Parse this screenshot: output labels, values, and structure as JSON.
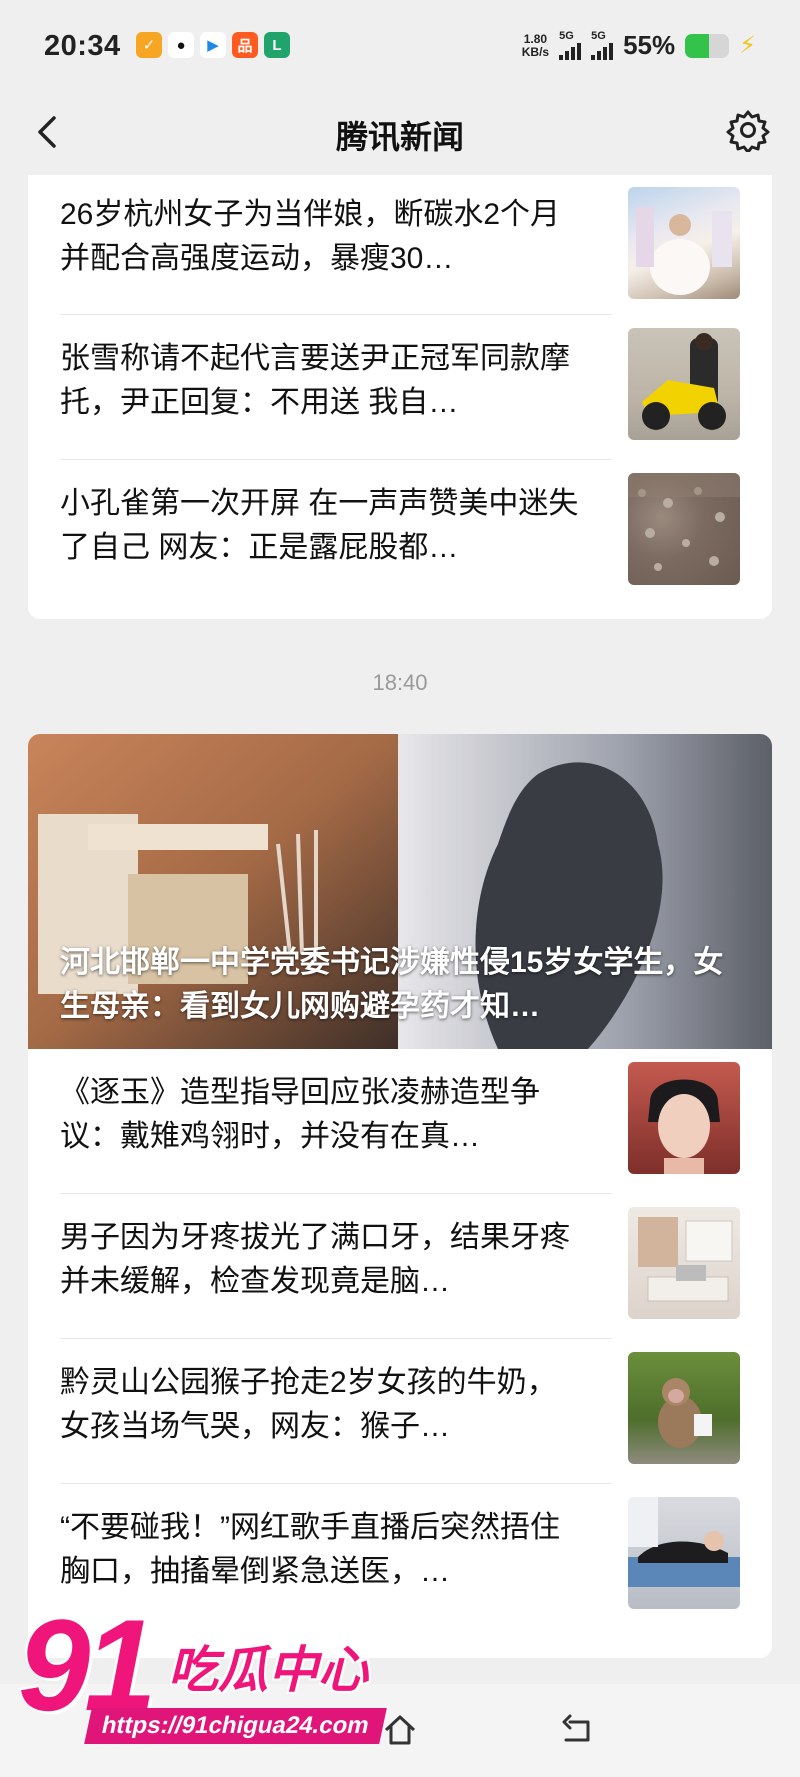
{
  "status_bar": {
    "time": "20:34",
    "net_speed_value": "1.80",
    "net_speed_unit": "KB/s",
    "sim1_label": "5G",
    "sim2_label": "5G",
    "battery_percent": "55%",
    "battery_level": 0.55,
    "colors": {
      "battery_fill": "#34c34a",
      "charge": "#f4c21e"
    }
  },
  "header": {
    "title": "腾讯新闻",
    "back_icon": "chevron-left-icon",
    "settings_icon": "gear-icon"
  },
  "card1": {
    "items": [
      {
        "headline": "26岁杭州女子为当伴娘，断碳水2个月并配合高强度运动，暴瘦30…",
        "thumb": "wedding-photo"
      },
      {
        "headline": "张雪称请不起代言要送尹正冠军同款摩托，尹正回复：不用送 我自…",
        "thumb": "motorcycle-photo"
      },
      {
        "headline": "小孔雀第一次开屏 在一声声赞美中迷失了自己 网友：正是露屁股都…",
        "thumb": "peacock-photo"
      }
    ]
  },
  "time_separator": "18:40",
  "card2": {
    "hero": {
      "caption": "河北邯郸一中学党委书记涉嫌性侵15岁女学生，女生母亲：看到女儿网购避孕药才知…"
    },
    "items": [
      {
        "headline": "《逐玉》造型指导回应张凌赫造型争议：戴雉鸡翎时，并没有在真…",
        "thumb": "actor-portrait"
      },
      {
        "headline": "男子因为牙疼拔光了满口牙，结果牙疼并未缓解，检查发现竟是脑…",
        "thumb": "clinic-room-photo"
      },
      {
        "headline": "黔灵山公园猴子抢走2岁女孩的牛奶，女孩当场气哭，网友：猴子…",
        "thumb": "monkey-photo"
      },
      {
        "headline": "“不要碰我！”网红歌手直播后突然捂住胸口，抽搐晕倒紧急送医，…",
        "thumb": "hospital-bed-photo"
      }
    ]
  },
  "watermark": {
    "number": "91",
    "name": "吃瓜中心",
    "url": "https://91chigua24.com"
  },
  "bottom_nav": {
    "home_icon": "home-icon",
    "back_icon": "return-icon"
  }
}
